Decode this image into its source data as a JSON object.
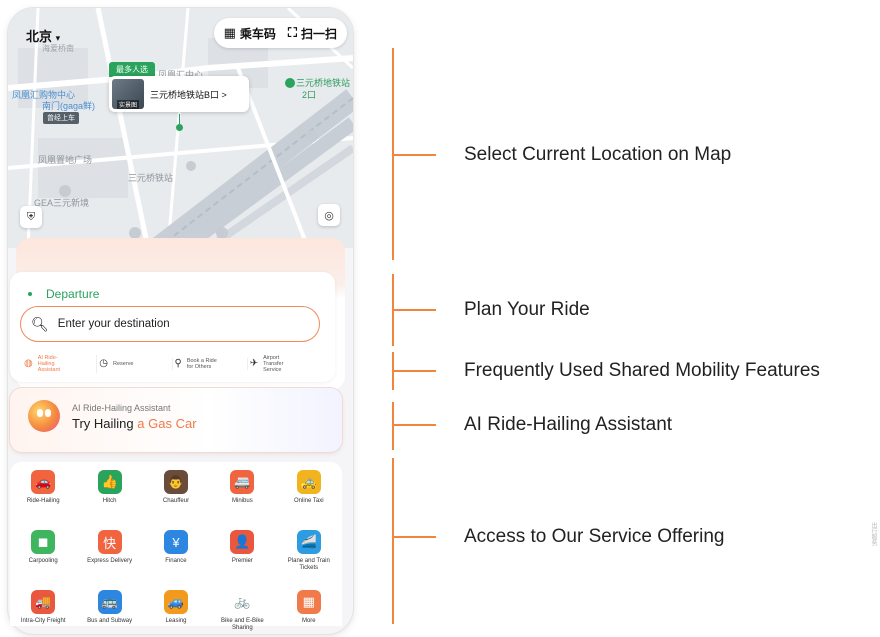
{
  "map": {
    "city": "北京",
    "ride_code_label": "乘车码",
    "scan_label": "扫一扫",
    "popular_tag": "最多人选",
    "station_name": "三元桥地铁站B口 >",
    "photo_label": "实景图",
    "labels": {
      "mall": "凤凰汇购物中心",
      "mall_gate": "南门(gaga鲜)",
      "badge": "曾经上车",
      "station_right": "三元桥地铁站",
      "station_right_2": "2口",
      "plaza": "凤凰置地广场",
      "gea": "GEA三元新境",
      "top_small": "海爱桥南",
      "phoenix_center": "凤凰汇中心",
      "line": "三元桥铁站"
    }
  },
  "plan": {
    "departure": "Departure",
    "destination_placeholder": "Enter your destination",
    "features": [
      {
        "label": "AI Ride-Hailing Assistant",
        "icon": "ai-icon"
      },
      {
        "label": "Reserve",
        "icon": "clock-icon"
      },
      {
        "label": "Book a Ride for Others",
        "icon": "person-icon"
      },
      {
        "label": "Airport Transfer Service",
        "icon": "plane-icon"
      }
    ]
  },
  "ai": {
    "subtitle": "AI Ride-Hailing Assistant",
    "title_prefix": "Try Hailing",
    "title_highlight": "a Gas Car"
  },
  "services": [
    {
      "label": "Ride-Hailing",
      "icon": "car-icon",
      "color": "#f0653f",
      "glyph": "🚗"
    },
    {
      "label": "Hitch",
      "icon": "thumb-icon",
      "color": "#2aa35d",
      "glyph": "👍"
    },
    {
      "label": "Chauffeur",
      "icon": "driver-icon",
      "color": "#6b4c3b",
      "glyph": "👨"
    },
    {
      "label": "Minibus",
      "icon": "bus-icon",
      "color": "#f0653f",
      "glyph": "🚐"
    },
    {
      "label": "Online Taxi",
      "icon": "taxi-icon",
      "color": "#f2b41e",
      "glyph": "🚕"
    },
    {
      "label": "Carpooling",
      "icon": "carpool-icon",
      "color": "#3fb55f",
      "glyph": "◼"
    },
    {
      "label": "Express Delivery",
      "icon": "delivery-icon",
      "color": "#f0653f",
      "glyph": "快"
    },
    {
      "label": "Finance",
      "icon": "finance-icon",
      "color": "#2d86e0",
      "glyph": "¥"
    },
    {
      "label": "Premier",
      "icon": "premier-icon",
      "color": "#e9573f",
      "glyph": "👤"
    },
    {
      "label": "Plane and Train Tickets",
      "icon": "train-icon",
      "color": "#2d9ce0",
      "glyph": "🚄"
    },
    {
      "label": "Intra-City Freight",
      "icon": "truck-icon",
      "color": "#e9573f",
      "glyph": "🚚"
    },
    {
      "label": "Bus and Subway",
      "icon": "subway-icon",
      "color": "#2d86e0",
      "glyph": "🚌"
    },
    {
      "label": "Leasing",
      "icon": "leasing-icon",
      "color": "#f29a1e",
      "glyph": "🚙"
    },
    {
      "label": "Bike and E-Bike Sharing",
      "icon": "bike-icon",
      "color": "#ffffff",
      "glyph": "🚲"
    },
    {
      "label": "More",
      "icon": "more-icon",
      "color": "#f07a4a",
      "glyph": "▦"
    }
  ],
  "side_note": "出行服务",
  "annotations": [
    "Select Current Location on Map",
    "Plan Your Ride",
    "Frequently Used Shared Mobility Features",
    "AI Ride-Hailing Assistant",
    "Access to Our Service Offering"
  ]
}
